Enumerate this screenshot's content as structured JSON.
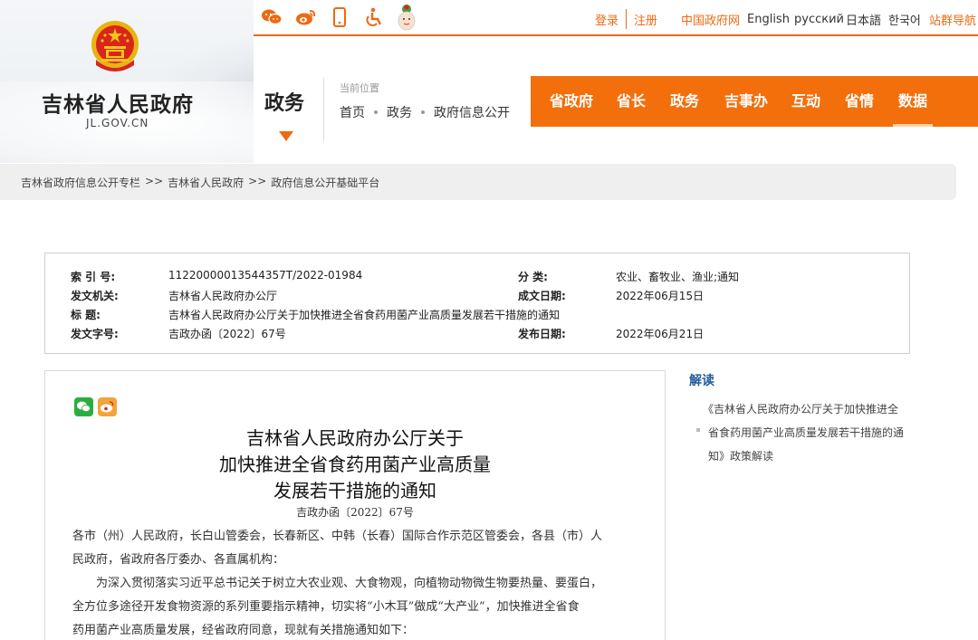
{
  "header": {
    "site_title": "吉林省人民政府",
    "site_domain": "JL.GOV.CN",
    "section_title": "政务",
    "location_label": "当前位置",
    "location_trail": [
      "首页",
      "政务",
      "政府信息公开"
    ]
  },
  "topbar": {
    "social_icons": [
      "wechat-icon",
      "weibo-icon",
      "mobile-icon",
      "accessibility-icon",
      "mascot-icon"
    ],
    "login": "登录",
    "register": "注册",
    "links": [
      "中国政府网",
      "English",
      "русский",
      "日本語",
      "한국어",
      "站群导航"
    ],
    "accent_color": "#ee6a10"
  },
  "mainnav": {
    "items": [
      "省政府",
      "省长",
      "政务",
      "吉事办",
      "互动",
      "省情",
      "数据"
    ],
    "active": "数据",
    "bg_color": "#f36f0c"
  },
  "breadcrumb": {
    "items": [
      "吉林省政府信息公开专栏",
      "吉林省人民政府",
      "政府信息公开基础平台"
    ],
    "separator": ">>"
  },
  "info": {
    "index_no_label": "索 引 号:",
    "index_no": "11220000013544357T/2022-01984",
    "category_label": "分 类:",
    "category": "农业、畜牧业、渔业;通知",
    "issuer_label": "发文机关:",
    "issuer": "吉林省人民政府办公厅",
    "created_label": "成文日期:",
    "created": "2022年06月15日",
    "title_label": "标 题:",
    "title": "吉林省人民政府办公厅关于加快推进全省食药用菌产业高质量发展若干措施的通知",
    "doc_no_label": "发文字号:",
    "doc_no": "吉政办函〔2022〕67号",
    "published_label": "发布日期:",
    "published": "2022年06月21日"
  },
  "document": {
    "title_lines": [
      "吉林省人民政府办公厅关于",
      "加快推进全省食药用菌产业高质量",
      "发展若干措施的通知"
    ],
    "doc_number": "吉政办函〔2022〕67号",
    "recipients_line1": "各市（州）人民政府，长白山管委会，长春新区、中韩（长春）国际合作示范区管委会，各县（市）人",
    "recipients_line2": "民政府，省政府各厅委办、各直属机构：",
    "body_line1": "为深入贯彻落实习近平总书记关于树立大农业观、大食物观，向植物动物微生物要热量、要蛋白，",
    "body_line2": "全方位多途径开发食物资源的系列重要指示精神，切实将“小木耳”做成“大产业”，加快推进全省食",
    "body_line3": "药用菌产业高质量发展，经省政府同意，现就有关措施通知如下："
  },
  "sidebar": {
    "title": "解读",
    "link": "《吉林省人民政府办公厅关于加快推进全省食药用菌产业高质量发展若干措施的通知》政策解读"
  }
}
